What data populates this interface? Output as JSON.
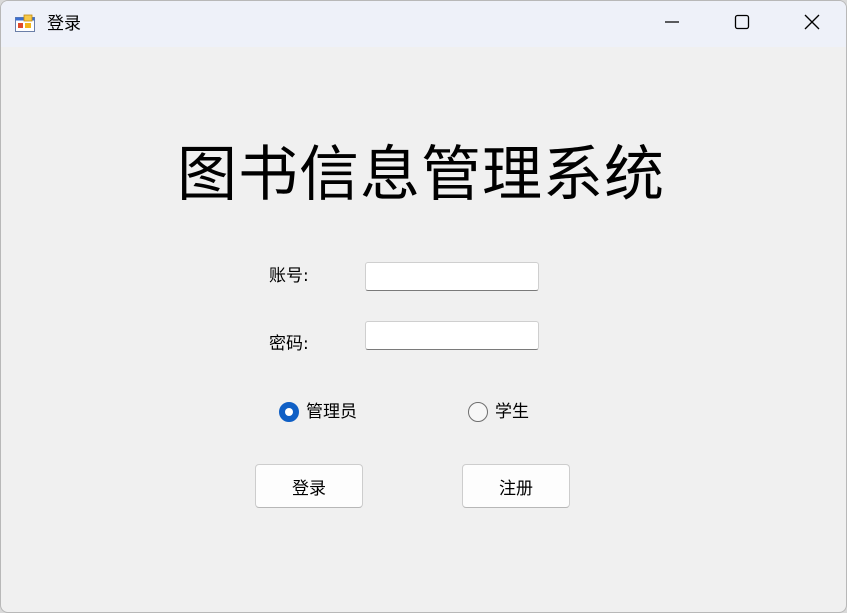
{
  "window": {
    "title": "登录",
    "icon": "app-window-icon",
    "controls": {
      "minimize": "minimize-icon",
      "maximize": "maximize-icon",
      "close": "close-icon"
    }
  },
  "form": {
    "heading": "图书信息管理系统",
    "account_label": "账号:",
    "account_value": "",
    "password_label": "密码:",
    "password_value": "",
    "roles": [
      {
        "label": "管理员",
        "checked": true
      },
      {
        "label": "学生",
        "checked": false
      }
    ],
    "login_label": "登录",
    "register_label": "注册"
  },
  "colors": {
    "titlebar": "#eef1f9",
    "background": "#f0f0f0",
    "radio_accent": "#0f5fc5"
  }
}
